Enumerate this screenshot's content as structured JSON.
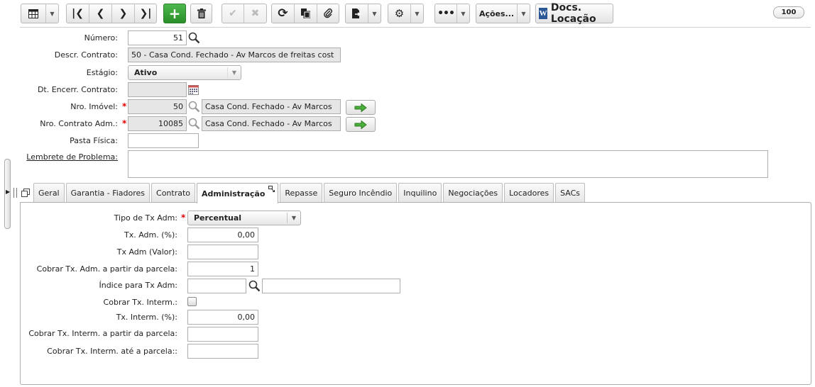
{
  "toolbar": {
    "acoes_label": "Ações...",
    "docs_label": "Docs. Locação",
    "docs_icon_letter": "W",
    "zoom": "100"
  },
  "form": {
    "numero_label": "Número:",
    "numero_value": "51",
    "descr_label": "Descr. Contrato:",
    "descr_value": "50 - Casa Cond. Fechado - Av Marcos de freitas cost",
    "estagio_label": "Estágio:",
    "estagio_value": "Ativo",
    "dt_encerr_label": "Dt. Encerr. Contrato:",
    "dt_encerr_value": "",
    "nro_imovel_label": "Nro. Imóvel:",
    "nro_imovel_value": "50",
    "nro_imovel_desc": "Casa Cond. Fechado - Av Marcos",
    "nro_contrato_adm_label": "Nro. Contrato Adm.:",
    "nro_contrato_adm_value": "10085",
    "nro_contrato_adm_desc": "Casa Cond. Fechado - Av Marcos",
    "pasta_fisica_label": "Pasta Física:",
    "pasta_fisica_value": "",
    "lembrete_label": "Lembrete de Problema:",
    "lembrete_value": ""
  },
  "tabs": [
    {
      "label": "Geral"
    },
    {
      "label": "Garantia - Fiadores"
    },
    {
      "label": "Contrato"
    },
    {
      "label": "Administração"
    },
    {
      "label": "Repasse"
    },
    {
      "label": "Seguro Incêndio"
    },
    {
      "label": "Inquilino"
    },
    {
      "label": "Negociações"
    },
    {
      "label": "Locadores"
    },
    {
      "label": "SACs"
    }
  ],
  "admin": {
    "tipo_tx_label": "Tipo de Tx Adm:",
    "tipo_tx_value": "Percentual",
    "tx_adm_pct_label": "Tx. Adm. (%):",
    "tx_adm_pct_value": "0,00",
    "tx_adm_valor_label": "Tx Adm (Valor):",
    "tx_adm_valor_value": "",
    "cobrar_parcela_label": "Cobrar Tx. Adm. a partir da parcela:",
    "cobrar_parcela_value": "1",
    "indice_label": "Índice para Tx Adm:",
    "indice_value": "",
    "indice_desc": "",
    "cobrar_interm_label": "Cobrar Tx. Interm.:",
    "tx_interm_pct_label": "Tx. Interm. (%):",
    "tx_interm_pct_value": "0,00",
    "cobrar_interm_parcela_label": "Cobrar Tx. Interm. a partir da parcela:",
    "cobrar_interm_parcela_value": "",
    "cobrar_interm_ate_label": "Cobrar Tx. Interm. até a parcela::",
    "cobrar_interm_ate_value": ""
  },
  "colors": {
    "accent_green": "#2f9a2f",
    "required_red": "#dd0000",
    "readonly_bg": "#e6e6e6"
  }
}
